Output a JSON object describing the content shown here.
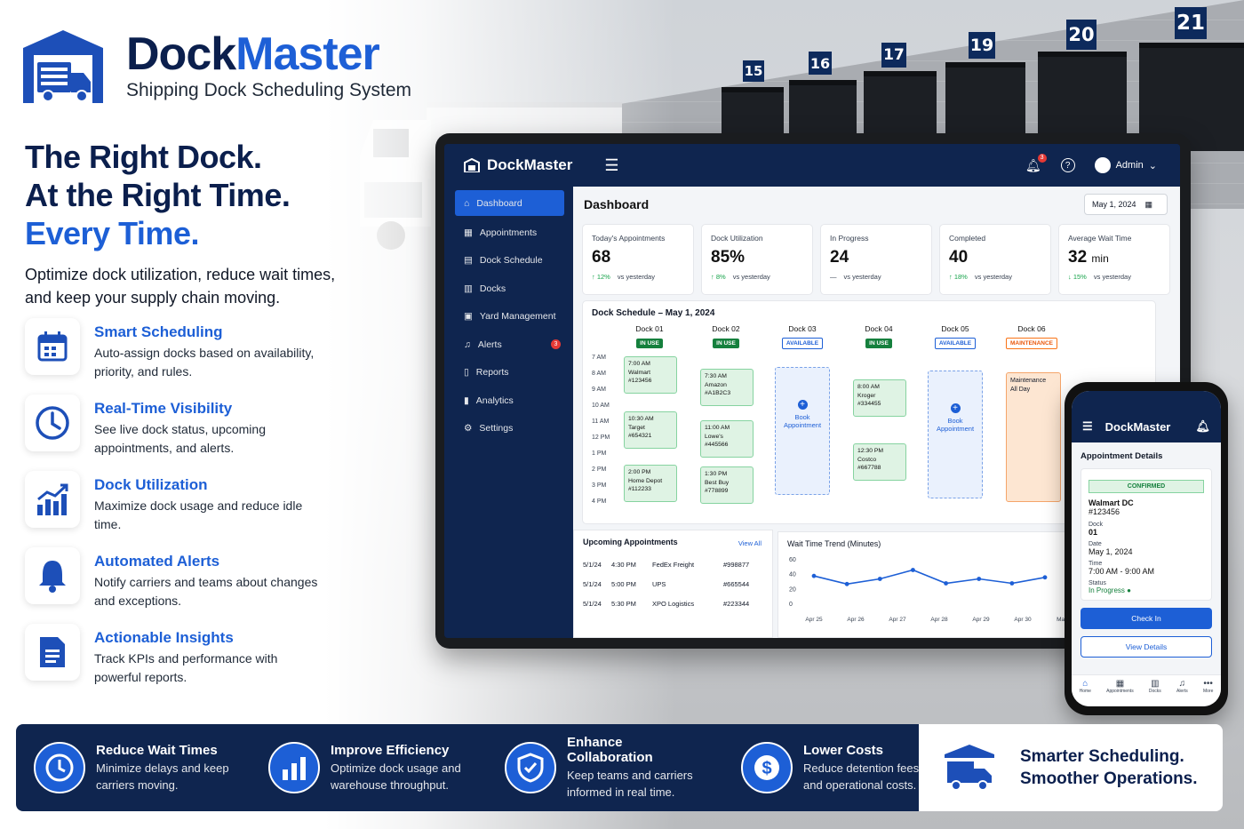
{
  "brand": {
    "name_part1": "Dock",
    "name_part2": "Master",
    "subtitle": "Shipping Dock Scheduling System"
  },
  "hero": {
    "line1": "The Right Dock.",
    "line2": "At the Right Time.",
    "line3": "Every Time.",
    "desc": "Optimize dock utilization, reduce wait times, and keep your supply chain moving."
  },
  "features": [
    {
      "title": "Smart Scheduling",
      "desc": "Auto-assign docks based on availability, priority, and rules.",
      "icon": "calendar-icon"
    },
    {
      "title": "Real-Time Visibility",
      "desc": "See live dock status, upcoming appointments, and alerts.",
      "icon": "clock-icon"
    },
    {
      "title": "Dock Utilization",
      "desc": "Maximize dock usage and reduce idle time.",
      "icon": "bar-chart-icon"
    },
    {
      "title": "Automated Alerts",
      "desc": "Notify carriers and teams about changes and exceptions.",
      "icon": "bell-icon"
    },
    {
      "title": "Actionable Insights",
      "desc": "Track KPIs and performance with powerful reports.",
      "icon": "document-icon"
    }
  ],
  "dock_numbers": [
    "15",
    "16",
    "17",
    "19",
    "20",
    "21"
  ],
  "app": {
    "name": "DockMaster",
    "notif_count": "3",
    "user": "Admin",
    "nav": [
      {
        "label": "Dashboard",
        "icon": "home-icon"
      },
      {
        "label": "Appointments",
        "icon": "calendar-icon"
      },
      {
        "label": "Dock Schedule",
        "icon": "schedule-icon"
      },
      {
        "label": "Docks",
        "icon": "dock-icon"
      },
      {
        "label": "Yard Management",
        "icon": "yard-icon"
      },
      {
        "label": "Alerts",
        "icon": "bell-icon",
        "badge": "3"
      },
      {
        "label": "Reports",
        "icon": "report-icon"
      },
      {
        "label": "Analytics",
        "icon": "analytics-icon"
      },
      {
        "label": "Settings",
        "icon": "gear-icon"
      }
    ],
    "page_title": "Dashboard",
    "date": "May 1, 2024",
    "kpis": [
      {
        "label": "Today's Appointments",
        "value": "68",
        "unit": "",
        "change": "↑ 12%",
        "note": "vs yesterday"
      },
      {
        "label": "Dock Utilization",
        "value": "85%",
        "unit": "",
        "change": "↑ 8%",
        "note": "vs yesterday"
      },
      {
        "label": "In Progress",
        "value": "24",
        "unit": "",
        "change": "—",
        "note": "vs yesterday"
      },
      {
        "label": "Completed",
        "value": "40",
        "unit": "",
        "change": "↑ 18%",
        "note": "vs yesterday"
      },
      {
        "label": "Average Wait Time",
        "value": "32",
        "unit": "min",
        "change": "↓ 15%",
        "note": "vs yesterday"
      }
    ],
    "schedule_title": "Dock Schedule – May 1, 2024",
    "times": [
      "7 AM",
      "8 AM",
      "9 AM",
      "10 AM",
      "11 AM",
      "12 PM",
      "1 PM",
      "2 PM",
      "3 PM",
      "4 PM"
    ],
    "docks": [
      {
        "name": "Dock 01",
        "status": "IN USE"
      },
      {
        "name": "Dock 02",
        "status": "IN USE"
      },
      {
        "name": "Dock 03",
        "status": "AVAILABLE"
      },
      {
        "name": "Dock 04",
        "status": "IN USE"
      },
      {
        "name": "Dock 05",
        "status": "AVAILABLE"
      },
      {
        "name": "Dock 06",
        "status": "MAINTENANCE"
      }
    ],
    "appointments": [
      {
        "time": "7:00 AM",
        "carrier": "Walmart",
        "ref": "#123456"
      },
      {
        "time": "10:30 AM",
        "carrier": "Target",
        "ref": "#654321"
      },
      {
        "time": "2:00 PM",
        "carrier": "Home Depot",
        "ref": "#112233"
      },
      {
        "time": "7:30 AM",
        "carrier": "Amazon",
        "ref": "#A1B2C3"
      },
      {
        "time": "11:00 AM",
        "carrier": "Lowe's",
        "ref": "#445566"
      },
      {
        "time": "1:30 PM",
        "carrier": "Best Buy",
        "ref": "#778899"
      },
      {
        "time": "8:00 AM",
        "carrier": "Kroger",
        "ref": "#334455"
      },
      {
        "time": "12:30 PM",
        "carrier": "Costco",
        "ref": "#667788"
      }
    ],
    "book_label": "Book Appointment",
    "maintenance": {
      "title": "Maintenance",
      "sub": "All Day"
    },
    "upcoming": {
      "title": "Upcoming Appointments",
      "view_all": "View All",
      "rows": [
        {
          "date": "5/1/24",
          "time": "4:30 PM",
          "carrier": "FedEx Freight",
          "ref": "#998877"
        },
        {
          "date": "5/1/24",
          "time": "5:00 PM",
          "carrier": "UPS",
          "ref": "#665544"
        },
        {
          "date": "5/1/24",
          "time": "5:30 PM",
          "carrier": "XPO Logistics",
          "ref": "#223344"
        }
      ]
    }
  },
  "chart_data": {
    "type": "line",
    "title": "Wait Time Trend (Minutes)",
    "x": [
      "Apr 25",
      "Apr 26",
      "Apr 27",
      "Apr 28",
      "Apr 29",
      "Apr 30",
      "May 1"
    ],
    "series": [
      {
        "values": [
          37,
          26,
          33,
          45,
          27,
          33,
          27,
          35
        ]
      }
    ],
    "ylim": [
      0,
      60
    ],
    "yticks": [
      "60",
      "40",
      "20",
      "0"
    ],
    "color": "#1d5fd6"
  },
  "phone": {
    "app_name": "DockMaster",
    "card_title": "Appointment Details",
    "status_badge": "CONFIRMED",
    "carrier": "Walmart DC",
    "ref": "#123456",
    "dock_label": "Dock",
    "dock": "01",
    "date_label": "Date",
    "date": "May 1, 2024",
    "time_label": "Time",
    "time": "7:00 AM - 9:00 AM",
    "status_label": "Status",
    "status": "In Progress",
    "checkin": "Check In",
    "view": "View Details",
    "nav": [
      "Home",
      "Appointments",
      "Docks",
      "Alerts",
      "More"
    ]
  },
  "benefits": [
    {
      "title": "Reduce Wait Times",
      "desc": "Minimize delays and keep carriers moving.",
      "icon": "clock-icon"
    },
    {
      "title": "Improve Efficiency",
      "desc": "Optimize dock usage and warehouse throughput.",
      "icon": "bar-chart-icon"
    },
    {
      "title": "Enhance Collaboration",
      "desc": "Keep teams and carriers informed in real time.",
      "icon": "shield-check-icon"
    },
    {
      "title": "Lower Costs",
      "desc": "Reduce detention fees and operational costs.",
      "icon": "dollar-icon"
    }
  ],
  "tagline": {
    "line1": "Smarter Scheduling.",
    "line2": "Smoother Operations."
  },
  "colors": {
    "navy": "#0f254f",
    "blue": "#1d5fd6",
    "green": "#15803d",
    "orange": "#ea580c"
  }
}
